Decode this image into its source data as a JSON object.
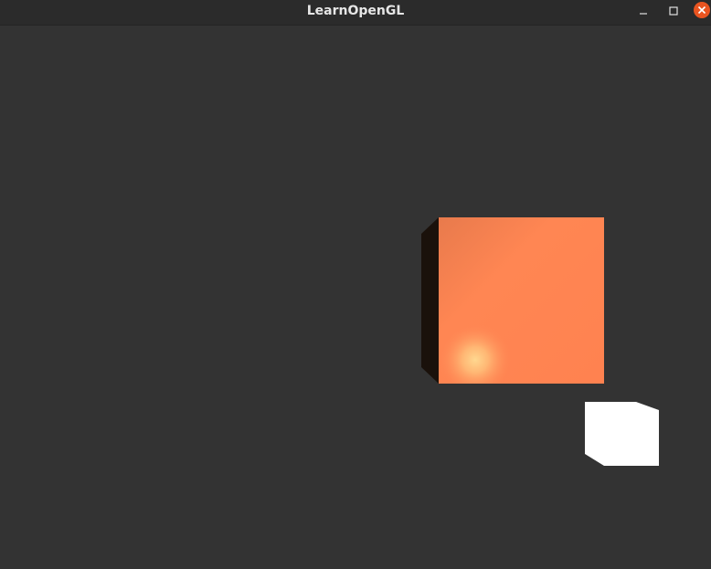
{
  "window": {
    "title": "LearnOpenGL",
    "controls": [
      "minimize",
      "maximize",
      "close"
    ],
    "close_color": "#e95420"
  },
  "scene": {
    "background_color": "#333333",
    "lit_cube": {
      "front_color": "#ff8552",
      "side_color": "#1a110b",
      "highlight_color": "#ffd38a"
    },
    "light_cube": {
      "color": "#ffffff"
    }
  }
}
